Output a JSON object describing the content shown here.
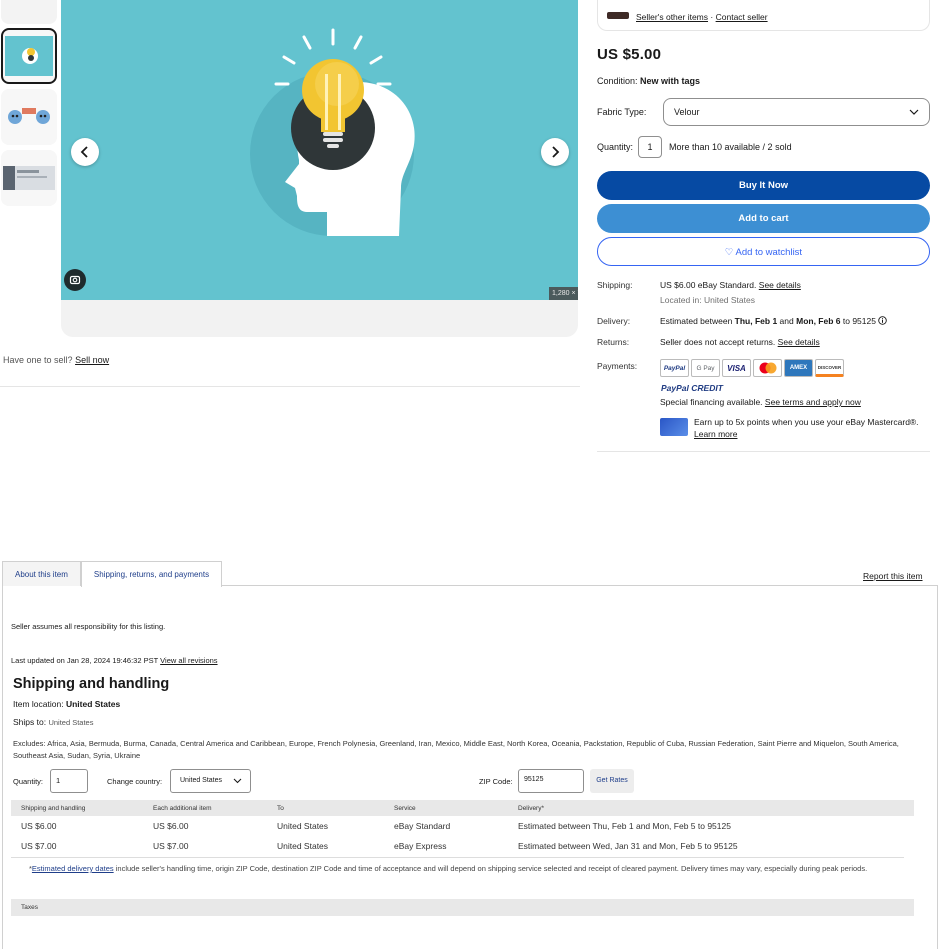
{
  "gallery": {
    "prev_label": "‹",
    "next_label": "›",
    "image_size": "1,280 × 7",
    "thumbnails": [
      "thumbnail 1",
      "thumbnail 2",
      "thumbnail 3",
      "thumbnail 4"
    ],
    "colors": {
      "hero_bg": "#63c3cf",
      "bulb": "#f2c531",
      "head": "#ffffff",
      "circle": "#2f3638"
    }
  },
  "sell": {
    "prefix": "Have one to sell?",
    "link": "Sell now"
  },
  "seller": {
    "other_items": "Seller's other items",
    "sep": "·",
    "contact": "Contact seller"
  },
  "product": {
    "price": "US $5.00",
    "condition_label": "Condition:",
    "condition_value": "New with tags",
    "fabric_label": "Fabric Type:",
    "fabric_value": "Velour",
    "quantity_label": "Quantity:",
    "quantity_value": "1",
    "availability": "More than 10 available / 2 sold"
  },
  "actions": {
    "buy_now": "Buy It Now",
    "add_to_cart": "Add to cart",
    "watchlist": "♡ Add to watchlist"
  },
  "shipping_summary": {
    "shipping_label": "Shipping:",
    "shipping_value": "US $6.00 eBay Standard.",
    "shipping_link": "See details",
    "location": "Located in: United States",
    "delivery_label": "Delivery:",
    "delivery_prefix": "Estimated between",
    "delivery_start": "Thu, Feb 1",
    "delivery_and": "and",
    "delivery_end": "Mon, Feb 6",
    "delivery_suffix": "to 95125",
    "returns_label": "Returns:",
    "returns_value": "Seller does not accept returns.",
    "returns_link": "See details",
    "payments_label": "Payments:",
    "payment_methods": [
      "PayPal",
      "G Pay",
      "VISA",
      "MC",
      "AMEX",
      "DISCOVER"
    ],
    "paypal_credit": "PayPal CREDIT",
    "financing_text": "Special financing available.",
    "financing_link": "See terms and apply now",
    "mastercard_text": "Earn up to 5x points when you use your eBay Mastercard®.",
    "mastercard_link": "Learn more"
  },
  "tabs": [
    {
      "label": "About this item",
      "active": false
    },
    {
      "label": "Shipping, returns, and payments",
      "active": true
    }
  ],
  "report": "Report this item",
  "details": {
    "responsibility": "Seller assumes all responsibility for this listing.",
    "updated_prefix": "Last updated on Jan 28, 2024 19:46:32 PST",
    "updated_link": "View all revisions",
    "heading": "Shipping and handling",
    "item_location_label": "Item location:",
    "item_location_value": "United States",
    "ships_to_label": "Ships to:",
    "ships_to_value": "United States",
    "excludes_label": "Excludes:",
    "excludes_value": "Africa, Asia, Bermuda, Burma, Canada, Central America and Caribbean, Europe, French Polynesia, Greenland, Iran, Mexico, Middle East, North Korea, Oceania, Packstation, Republic of Cuba, Russian Federation, Saint Pierre and Miquelon, South America, Southeast Asia, Sudan, Syria, Ukraine"
  },
  "calculator": {
    "quantity_label": "Quantity:",
    "quantity_value": "1",
    "country_label": "Change country:",
    "country_value": "United States",
    "zip_label": "ZIP Code:",
    "zip_value": "95125",
    "rates_button": "Get Rates"
  },
  "shipping_table": {
    "headers": [
      "Shipping and handling",
      "Each additional item",
      "To",
      "Service",
      "Delivery*"
    ],
    "rows": [
      [
        "US $6.00",
        "US $6.00",
        "United States",
        "eBay Standard",
        "Estimated between Thu, Feb 1 and Mon, Feb 5 to 95125"
      ],
      [
        "US $7.00",
        "US $7.00",
        "United States",
        "eBay Express",
        "Estimated between Wed, Jan 31 and Mon, Feb 5 to 95125"
      ]
    ]
  },
  "note": {
    "star": "*",
    "link": "Estimated delivery dates",
    "text": "include seller's handling time, origin ZIP Code, destination ZIP Code and time of acceptance and will depend on shipping service selected and receipt of cleared payment. Delivery times may vary, especially during peak periods."
  },
  "taxes": "Taxes"
}
